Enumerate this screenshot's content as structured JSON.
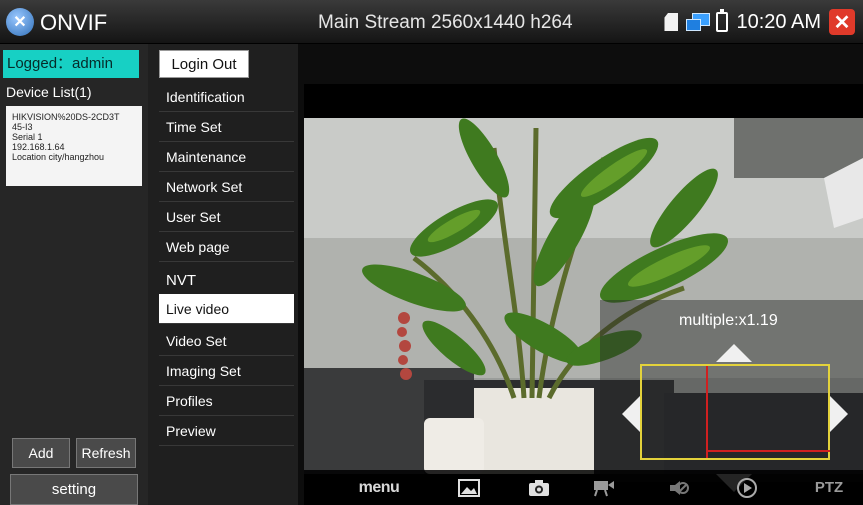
{
  "app": {
    "name": "ONVIF",
    "stream_title": "Main Stream 2560x1440 h264",
    "clock": "10:20 AM",
    "close_glyph": "✕"
  },
  "left_panel": {
    "logged_status": "Logged：admin",
    "device_list_title": "Device List(1)",
    "device": {
      "name_line1": "HIKVISION%20DS-2CD3T",
      "name_line2": "45-I3",
      "serial": "Serial 1",
      "ip": "192.168.1.64",
      "location": "Location city/hangzhou"
    },
    "add_label": "Add",
    "refresh_label": "Refresh",
    "setting_label": "setting"
  },
  "menu": {
    "login_out_label": "Login Out",
    "items_top": [
      "Identification",
      "Time Set",
      "Maintenance",
      "Network Set",
      "User Set",
      "Web page"
    ],
    "section_header": "NVT",
    "items_bottom": [
      "Live video",
      "Video Set",
      "Imaging Set",
      "Profiles",
      "Preview"
    ],
    "selected": "Live video"
  },
  "video": {
    "multiple_label": "multiple:x1.19",
    "toolbar": {
      "menu_label": "menu",
      "ptz_label": "PTZ",
      "icons": [
        "image-icon",
        "camera-icon",
        "video-record-icon",
        "mute-icon",
        "play-icon"
      ]
    }
  },
  "colors": {
    "accent": "#17d0c4",
    "close": "#e03a2a",
    "zoom_box": "#e3d23b",
    "crosshair": "#d02020"
  }
}
